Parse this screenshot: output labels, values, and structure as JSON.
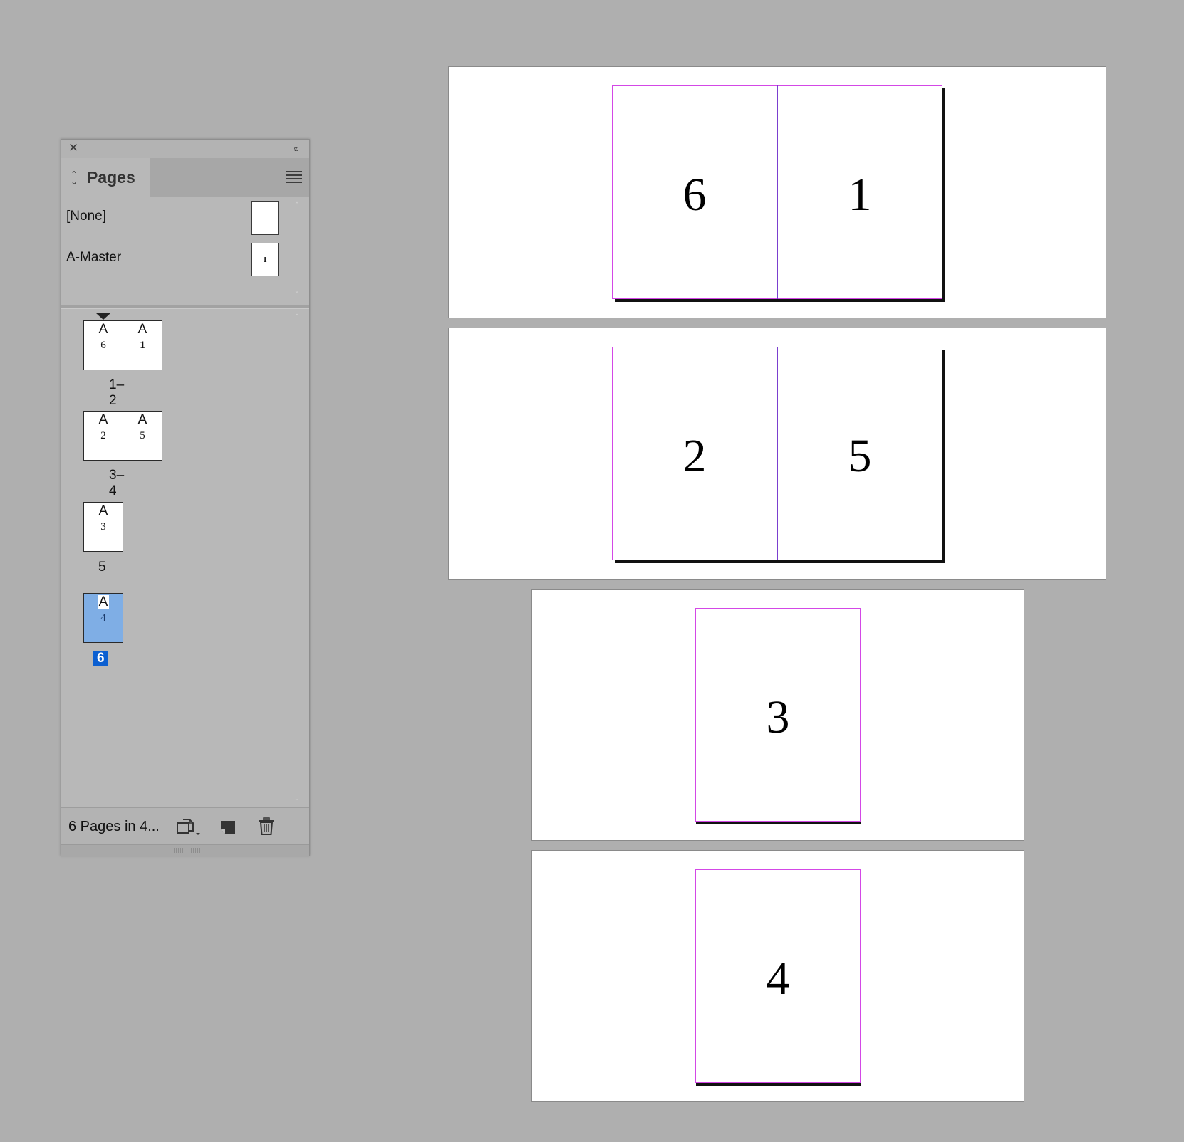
{
  "panel": {
    "close_icon": "close-icon",
    "collapse_icon": "collapse-icon",
    "collapse_glyph": "‹‹",
    "tab_label": "Pages",
    "menu_icon": "panel-menu-icon",
    "masters": [
      {
        "label": "[None]",
        "thumb_text": ""
      },
      {
        "label": "A-Master",
        "thumb_text": "1"
      }
    ],
    "spreads": [
      {
        "label": "1–2",
        "pages": [
          {
            "master": "A",
            "number": "6"
          },
          {
            "master": "A",
            "number": "1"
          }
        ]
      },
      {
        "label": "3–4",
        "pages": [
          {
            "master": "A",
            "number": "2"
          },
          {
            "master": "A",
            "number": "5"
          }
        ]
      },
      {
        "label": "5",
        "pages": [
          {
            "master": "A",
            "number": "3"
          }
        ]
      },
      {
        "label": "6",
        "pages": [
          {
            "master": "A",
            "number": "4"
          }
        ],
        "selected": true
      }
    ],
    "footer": {
      "status": "6 Pages in 4...",
      "edit_page_size_icon": "edit-page-size-icon",
      "new_page_icon": "new-page-icon",
      "delete_page_icon": "trash-icon"
    },
    "colors": {
      "selected_thumb": "#7faee5",
      "selected_label_bg": "#0b5fd1"
    }
  },
  "document": {
    "spreads": [
      {
        "pages": [
          "6",
          "1"
        ]
      },
      {
        "pages": [
          "2",
          "5"
        ]
      },
      {
        "pages": [
          "3"
        ]
      },
      {
        "pages": [
          "4"
        ]
      }
    ],
    "colors": {
      "pasteboard": "#afafaf",
      "margin_guide": "#d347e6",
      "spine": "#7b3fcf"
    }
  }
}
